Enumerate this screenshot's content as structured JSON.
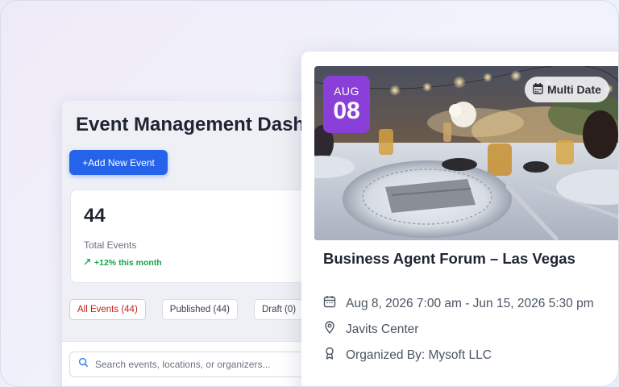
{
  "dashboard": {
    "title": "Event Management Dashboard",
    "add_button_label": "+Add New Event",
    "stat": {
      "value": "44",
      "label": "Total Events",
      "trend": "+12% this month"
    },
    "filters": [
      {
        "label": "All Events (44)",
        "active": true
      },
      {
        "label": "Published (44)",
        "active": false
      },
      {
        "label": "Draft (0)",
        "active": false
      }
    ],
    "search": {
      "placeholder": "Search events, locations, or organizers..."
    }
  },
  "event_card": {
    "date_badge": {
      "month": "AUG",
      "day": "08"
    },
    "multi_date_label": "Multi Date",
    "title": "Business Agent Forum – Las Vegas",
    "schedule": "Aug 8, 2026 7:00 am - Jun 15, 2026 5:30 pm",
    "venue": "Javits Center",
    "organizer": "Organized By: Mysoft LLC"
  },
  "colors": {
    "primary": "#2563eb",
    "badge_purple": "#8b3fd9",
    "trend_green": "#16a34a",
    "active_filter_red": "#c81e1e"
  }
}
